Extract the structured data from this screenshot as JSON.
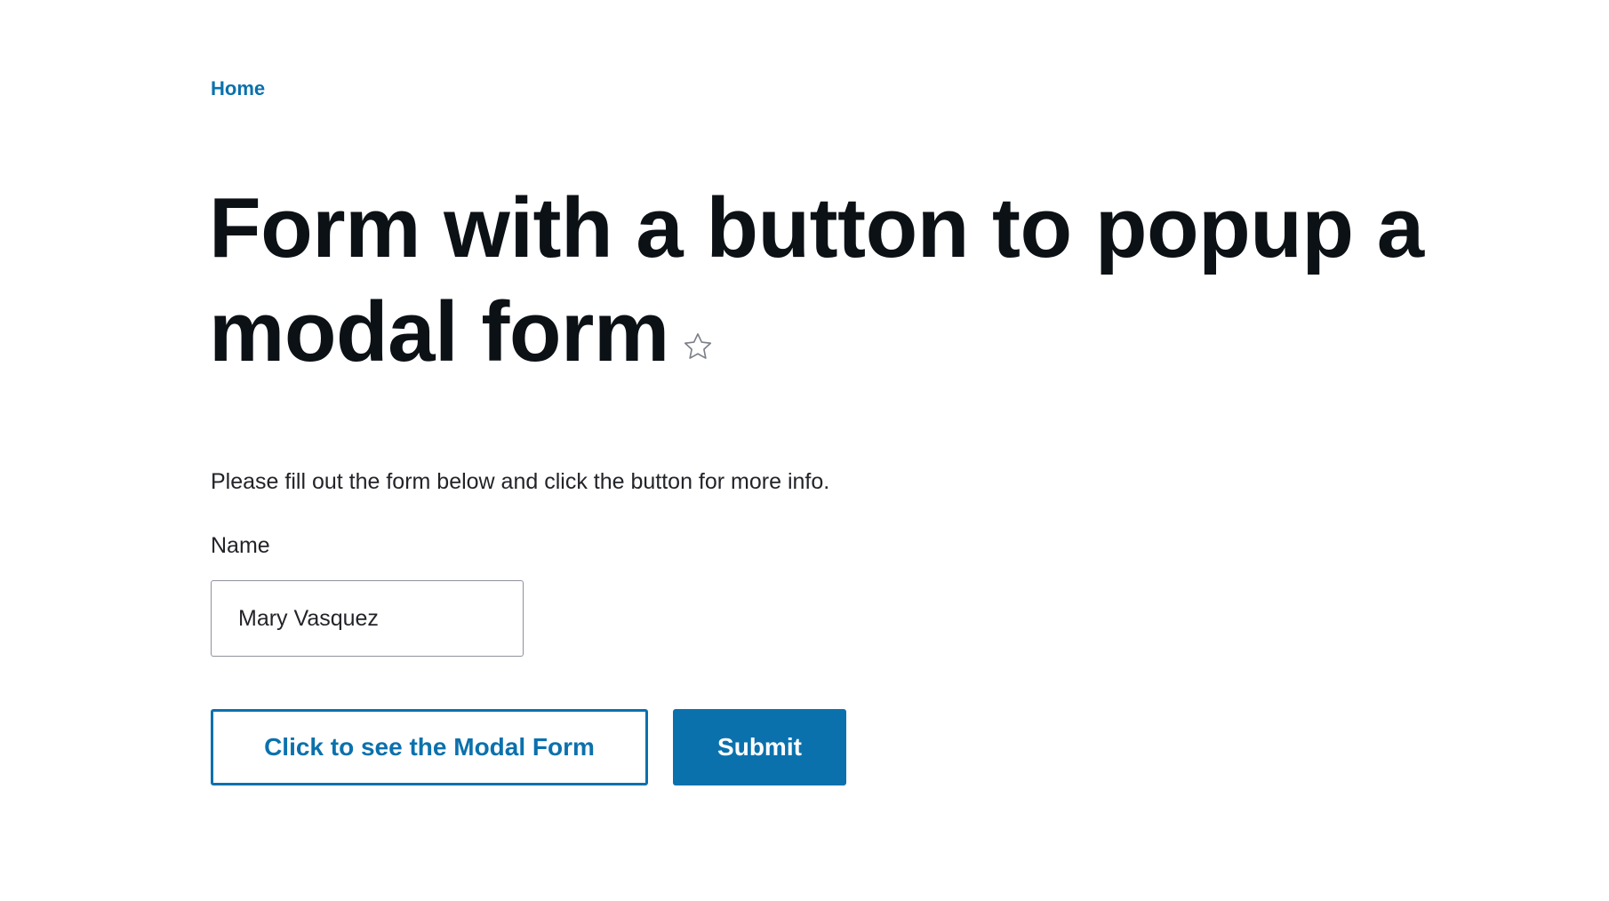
{
  "breadcrumb": {
    "home_label": "Home"
  },
  "page": {
    "title": "Form with a button to popup a modal form",
    "star_icon": "star-outline-icon",
    "intro_text": "Please fill out the form below and click the button for more info."
  },
  "form": {
    "name_label": "Name",
    "name_value": "Mary Vasquez",
    "modal_button_label": "Click to see the Modal Form",
    "submit_button_label": "Submit"
  },
  "colors": {
    "accent": "#0b71ad",
    "title_text": "#0c1116",
    "body_text": "#232429",
    "input_border": "#8e929c"
  }
}
